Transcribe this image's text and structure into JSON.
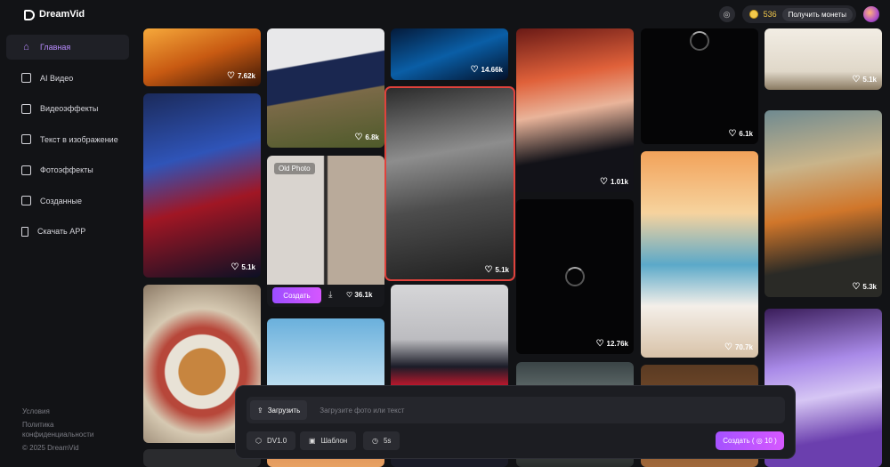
{
  "app": {
    "name": "DreamVid"
  },
  "header": {
    "coins": "536",
    "get_coins_label": "Получить монеты"
  },
  "sidebar": {
    "items": [
      {
        "label": "Главная",
        "icon": "home-icon",
        "active": true
      },
      {
        "label": "AI Видео",
        "icon": "ai-video-icon"
      },
      {
        "label": "Видеоэффекты",
        "icon": "video-effects-icon"
      },
      {
        "label": "Текст в изображение",
        "icon": "text-to-image-icon"
      },
      {
        "label": "Фотоэффекты",
        "icon": "photo-effects-icon"
      },
      {
        "label": "Созданные",
        "icon": "created-icon"
      },
      {
        "label": "Скачать APP",
        "icon": "download-app-icon"
      }
    ],
    "footer": {
      "terms": "Условия",
      "privacy_1": "Политика",
      "privacy_2": "конфиденциальности",
      "copyright": "© 2025 DreamVid"
    }
  },
  "cards": [
    {
      "likes": "7.62k"
    },
    {
      "likes": "6.8k"
    },
    {
      "likes": "14.66k"
    },
    {
      "likes": "1.01k"
    },
    {
      "likes": "6.1k"
    },
    {
      "likes": "5.1k"
    },
    {
      "likes": "5.1k"
    },
    {
      "likes": "5.1k"
    },
    {
      "likes": "5.3k"
    },
    {
      "likes": "12.76k"
    },
    {
      "likes": "70.7k"
    }
  ],
  "featured_card": {
    "title": "Old Photo",
    "create_label": "Создать",
    "likes": "36.1k"
  },
  "prompt": {
    "upload_label": "Загрузить",
    "placeholder": "Загрузите фото или текст",
    "model": "DV1.0",
    "template": "Шаблон",
    "duration": "5s",
    "submit_label": "Создать ( ◎ 10 )"
  }
}
